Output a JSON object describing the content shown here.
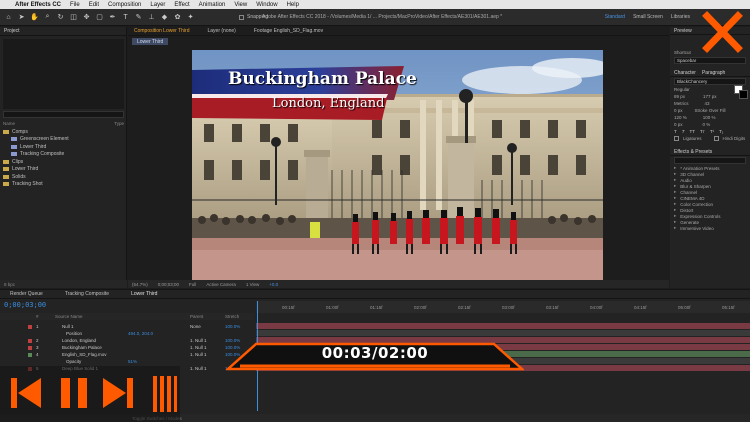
{
  "menubar": {
    "app_name": "After Effects CC",
    "items": [
      "File",
      "Edit",
      "Composition",
      "Layer",
      "Effect",
      "Animation",
      "View",
      "Window",
      "Help"
    ]
  },
  "toolbar": {
    "snapping_label": "Snapping",
    "doc_title": "Adobe After Effects CC 2018 - /Volumes/Media 1/ ... Projects/MacProVideo/After Effects/AE301/AE301.aep *",
    "workspaces": [
      "Standard",
      "Small Screen",
      "Libraries"
    ]
  },
  "project": {
    "tab": "Project",
    "cols": [
      "Name",
      "Type"
    ],
    "tree": [
      {
        "label": "Comps",
        "kind": "folder",
        "level": 0
      },
      {
        "label": "Greenscreen Element",
        "kind": "comp",
        "level": 1
      },
      {
        "label": "Lower Third",
        "kind": "comp",
        "level": 1
      },
      {
        "label": "Tracking Composite",
        "kind": "comp",
        "level": 1
      },
      {
        "label": "Clips",
        "kind": "folder",
        "level": 0
      },
      {
        "label": "Lower Third",
        "kind": "folder",
        "level": 0
      },
      {
        "label": "Solids",
        "kind": "folder",
        "level": 0
      },
      {
        "label": "Tracking Shot",
        "kind": "folder",
        "level": 0
      }
    ],
    "bpc": "8 bpc"
  },
  "viewer": {
    "tabs": [
      "Composition Lower Third",
      "Layer (none)",
      "Footage English_SD_Flag.mov"
    ],
    "subtab": "Lower Third",
    "zoom": "(54.7%)",
    "timecode": "0;00;03;00",
    "resolution": "Full",
    "camera": "Active Camera",
    "views": "1 View",
    "offset": "+0.0"
  },
  "lower_third": {
    "title": "Buckingham Palace",
    "subtitle": "London, England"
  },
  "right": {
    "preview_tab": "Preview",
    "shortcut_label": "Shortcut",
    "shortcut_value": "Spacebar",
    "character_tab": "Character",
    "paragraph_tab": "Paragraph",
    "font": "BlackChancery",
    "style": "Regular",
    "size": "89 px",
    "leading": "177 px",
    "kerning": "Metrics",
    "tracking": "43",
    "stroke": "Stroke Over Fill",
    "vscale": "120 %",
    "hscale": "100 %",
    "baseline": "0 px",
    "tsume": "0 %",
    "ligatures": "Ligatures",
    "hindi": "Hindi Digits",
    "effects_tab": "Effects & Presets",
    "effects": [
      "* Animation Presets",
      "3D Channel",
      "Audio",
      "Blur & Sharpen",
      "Channel",
      "CINEMA 4D",
      "Color Correction",
      "Distort",
      "Expression Controls",
      "Generate",
      "Immersive Video"
    ]
  },
  "timeline": {
    "tabs": [
      "Render Queue",
      "Tracking Composite",
      "Lower Third"
    ],
    "timecode": "0;00;03;00",
    "header": [
      "#",
      "Source Name",
      "Parent",
      "Stretch"
    ],
    "layers": [
      {
        "num": "1",
        "name": "Null 1",
        "color": "#c04040",
        "parent": "None",
        "stretch": "100.0%"
      },
      {
        "num": "",
        "name": "Position",
        "color": "",
        "parent": "",
        "stretch": "",
        "value": "494.0, 204.0"
      },
      {
        "num": "2",
        "name": "London, England",
        "color": "#c04040",
        "parent": "1. Null 1",
        "stretch": "100.0%"
      },
      {
        "num": "3",
        "name": "Buckingham Palace",
        "color": "#c04040",
        "parent": "1. Null 1",
        "stretch": "100.0%"
      },
      {
        "num": "4",
        "name": "English_SD_Flag.mov",
        "color": "#5a8a5a",
        "parent": "1. Null 1",
        "stretch": "100.0%"
      },
      {
        "num": "",
        "name": "Opacity",
        "color": "",
        "parent": "",
        "stretch": "",
        "value": "51%"
      },
      {
        "num": "5",
        "name": "Deep Blue Solid 1",
        "color": "#c04040",
        "parent": "1. Null 1",
        "stretch": "100.0%"
      }
    ],
    "ruler": [
      "00:15f",
      "01:00f",
      "01:15f",
      "02:00f",
      "02:15f",
      "03:00f",
      "03:15f",
      "04:00f",
      "04:15f",
      "05:00f",
      "05:15f"
    ],
    "footer": "Toggle Switches / Modes"
  },
  "overlay": {
    "timer": "00:03/02:00",
    "accent": "#ff5a00"
  },
  "icons": [
    "apple-icon",
    "close-icon",
    "skip-back-icon",
    "pause-icon",
    "skip-forward-icon"
  ]
}
